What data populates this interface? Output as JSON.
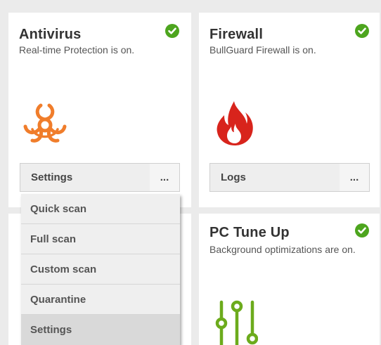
{
  "antivirus": {
    "title": "Antivirus",
    "subtitle": "Real-time Protection is on.",
    "status_icon": "check-circle-icon",
    "icon": "biohazard-icon",
    "icon_color": "#f07d2b",
    "settings_label": "Settings",
    "more_label": "..."
  },
  "firewall": {
    "title": "Firewall",
    "subtitle": "BullGuard Firewall is on.",
    "status_icon": "check-circle-icon",
    "icon": "flame-icon",
    "icon_color": "#d8241c",
    "logs_label": "Logs",
    "more_label": "..."
  },
  "pc_tune_up": {
    "title": "PC Tune Up",
    "subtitle": "Background optimizations are on.",
    "status_icon": "check-circle-icon",
    "icon": "sliders-icon",
    "icon_color": "#6cab1c"
  },
  "dropdown_menu": {
    "items": [
      "Quick scan",
      "Full scan",
      "Custom scan",
      "Quarantine",
      "Settings"
    ],
    "highlighted_item": "Settings"
  },
  "colors": {
    "status_green": "#4da51e",
    "background": "#ebebeb",
    "card": "#ffffff"
  }
}
